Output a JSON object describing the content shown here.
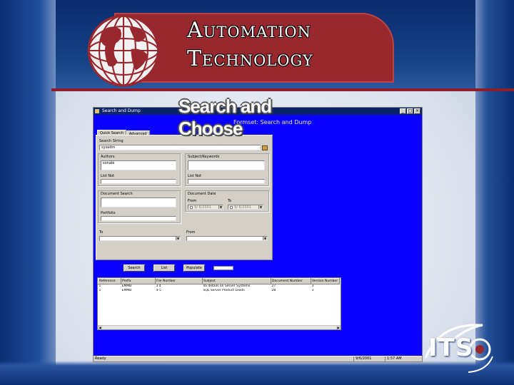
{
  "slide": {
    "title_line1": "Automation",
    "title_line2": "Technology",
    "subtitle": "Search and Choose",
    "logo_text": "ITS",
    "colors": {
      "banner_red": "#98272e",
      "slide_blue": "#0a2c70",
      "app_blue": "#0a00ff"
    }
  },
  "window": {
    "title": "Search and Dump",
    "form_title": "Formset: Search and Dump",
    "controls": {
      "minimize": "_",
      "maximize": "□",
      "close": "×"
    }
  },
  "tabs": [
    {
      "label": "Quick Search"
    },
    {
      "label": "Advanced"
    }
  ],
  "form": {
    "search_string_label": "Search String",
    "search_string_value": "sysadm",
    "authors_label": "Authors",
    "authors_value": "sonale",
    "subject_label": "Subject/Keywords",
    "subject_value": "",
    "list_not_label_1": "List Not",
    "list_not_label_2": "List Not",
    "document_search_label": "Document Search",
    "document_date_label": "Document Date",
    "from_label": "From",
    "to_label": "To",
    "from_date": "9/ 6/2001",
    "to_date": "9/ 6/2001",
    "portfolio_label": "Portfolio",
    "to_combo_label": "To",
    "from_combo_label": "From"
  },
  "buttons": {
    "search": "Search",
    "list": "List",
    "populate": "Populate"
  },
  "results": {
    "columns": [
      "Reference",
      "Prefix",
      "File Number",
      "Subject",
      "Document Number",
      "Version Number"
    ],
    "rows": [
      [
        "1",
        "EMMB",
        "3 4",
        "IIS details on Server Systems",
        "27",
        "3"
      ],
      [
        "1",
        "EMMB",
        "4-5",
        "SQL Server Product Leads",
        "28",
        "3"
      ]
    ]
  },
  "status": {
    "text": "Ready",
    "date": "9/6/2001",
    "time": "1:57 AM"
  }
}
